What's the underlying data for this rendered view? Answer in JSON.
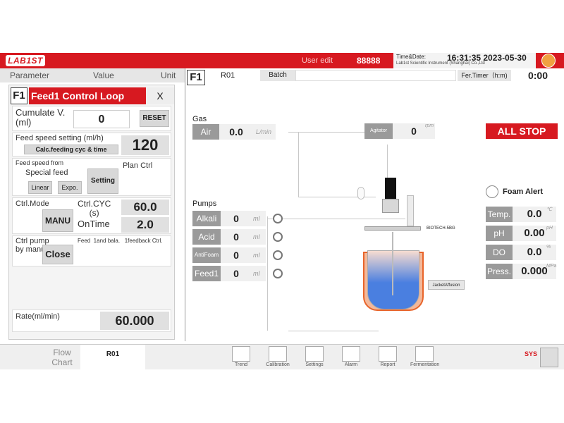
{
  "header": {
    "logo": "LAB1ST",
    "user_edit": "User edit",
    "user_number": "88888",
    "date_label": "Time&Date:",
    "date_value": "16:31:35 2023-05-30",
    "company": "Lab1st Scientific Instrument (Shanghai) Co.,Ltd"
  },
  "columns": {
    "parameter": "Parameter",
    "value": "Value",
    "unit": "Unit"
  },
  "dialog": {
    "badge": "F1",
    "title": "Feed1 Control Loop",
    "close": "X",
    "cumulate_label": "Cumulate V.\n(ml)",
    "cumulate_value": "0",
    "reset": "RESET",
    "feed_speed_label": "Feed speed setting (ml/h)",
    "calc_button": "Calc.feeding cyc & time",
    "feed_speed_value": "120",
    "feed_from_label": "Feed speed from",
    "special_feed": "Special feed",
    "plan_ctrl": "Plan Ctrl",
    "linear": "Linear",
    "expo": "Expo.",
    "setting": "Setting",
    "ctrl_mode_label": "Ctrl.Mode",
    "manu": "MANU",
    "ctrl_cyc_label": "Ctrl.CYC\n(s)",
    "ctrl_cyc_value": "60.0",
    "ontime_label": "OnTime",
    "ontime_value": "2.0",
    "ctrl_pump_label": "Ctrl pump\nby manu",
    "close_button": "Close",
    "feed_bala_text": "Feed  1and bala.   1feedback Ctrl.",
    "rate_label": "Rate(ml/min)",
    "rate_value": "60.000"
  },
  "main": {
    "badge": "F1",
    "r01": "R01",
    "batch": "Batch",
    "fer_timer_label": "Fer.Timer（h:m)",
    "fer_timer_value": "0:00",
    "gas_label": "Gas",
    "air_label": "Air",
    "air_value": "0.0",
    "air_unit": "L/min",
    "agitator_label": "Agitator",
    "agitator_value": "0",
    "agitator_unit": "rpm",
    "all_stop": "ALL STOP",
    "foam_alert": "Foam Alert",
    "pumps_label": "Pumps",
    "pumps": [
      {
        "label": "Alkali",
        "value": "0",
        "unit": "ml"
      },
      {
        "label": "Acid",
        "value": "0",
        "unit": "ml"
      },
      {
        "label": "AntiFoam",
        "value": "0",
        "unit": "ml"
      },
      {
        "label": "Feed1",
        "value": "0",
        "unit": "ml"
      }
    ],
    "vessel_label": "BIOTECH-5BG",
    "jacket_label": "JacketAffusion",
    "sensors": [
      {
        "label": "Temp.",
        "value": "0.0",
        "unit": "℃"
      },
      {
        "label": "pH",
        "value": "0.00",
        "unit": "pH"
      },
      {
        "label": "DO",
        "value": "0.0",
        "unit": "%"
      },
      {
        "label": "Press.",
        "value": "0.000",
        "unit": "MPa"
      }
    ]
  },
  "footer": {
    "flow_chart": "Flow\nChart",
    "r01": "R01",
    "nav": [
      "Trend",
      "Calibration",
      "Settings",
      "Alarm",
      "Report",
      "Fermentation"
    ],
    "sys": "SYS"
  },
  "colors": {
    "brand_red": "#d71920",
    "label_gray": "#9a9a9a",
    "vessel_blue": "#4a7fe0",
    "jacket_orange": "#e8642a"
  }
}
